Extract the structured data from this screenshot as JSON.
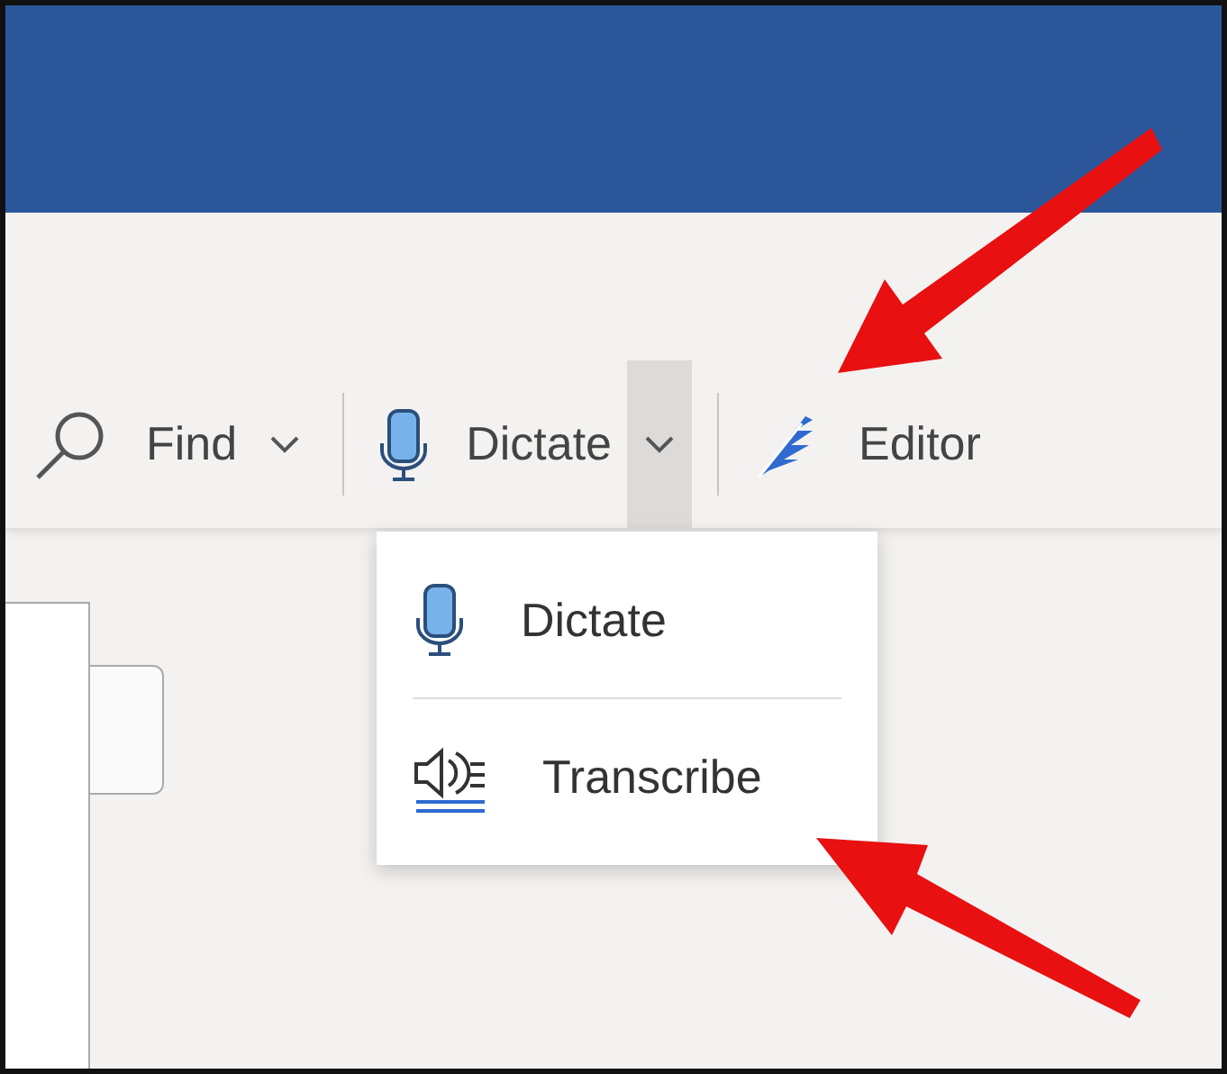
{
  "toolbar": [
    {
      "kind": "find",
      "label": "Find",
      "has_menu": true
    },
    {
      "kind": "dictate",
      "label": "Dictate",
      "has_menu": true,
      "expanded": true
    },
    {
      "kind": "editor",
      "label": "Editor",
      "has_menu": false
    }
  ],
  "dictate_menu": [
    {
      "kind": "dictate",
      "label": "Dictate"
    },
    {
      "kind": "transcribe",
      "label": "Transcribe"
    }
  ]
}
